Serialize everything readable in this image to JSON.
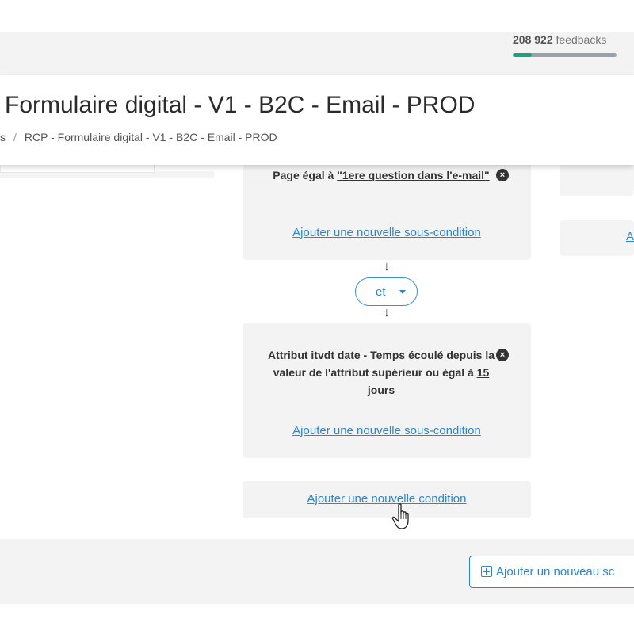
{
  "feedbacks": {
    "count": "208 922",
    "label": "feedbacks",
    "progress": 0.18,
    "progress_color": "#1aa37a"
  },
  "header": {
    "title": "Formulaire digital - V1 - B2C - Email - PROD",
    "breadcrumb": [
      "s",
      "RCP - Formulaire digital - V1 - B2C - Email - PROD"
    ]
  },
  "conditions": [
    {
      "text_prefix": "Page égal à ",
      "text_value": "\"1ere question dans l'e-mail\"",
      "remove_label": "×",
      "add_sub_label": "Ajouter une nouvelle sous-condition"
    },
    {
      "text_prefix": "Attribut itvdt date - Temps écoulé depuis la valeur de l'attribut supérieur ou égal à ",
      "text_value": "15 jours",
      "remove_label": "×",
      "add_sub_label": "Ajouter une nouvelle sous-condition"
    }
  ],
  "operator": {
    "selected": "et"
  },
  "arrows": {
    "down": "↓"
  },
  "add_condition_label": "Ajouter une nouvelle condition",
  "right_link_fragment": "A",
  "add_scenario_label": "Ajouter un nouveau sc",
  "colors": {
    "accent": "#2a86d1",
    "card_bg": "#f3f3f3",
    "text": "#333333"
  },
  "icons": [
    "remove-icon",
    "caret-down-icon",
    "plus-square-icon",
    "hand-pointer-icon"
  ]
}
